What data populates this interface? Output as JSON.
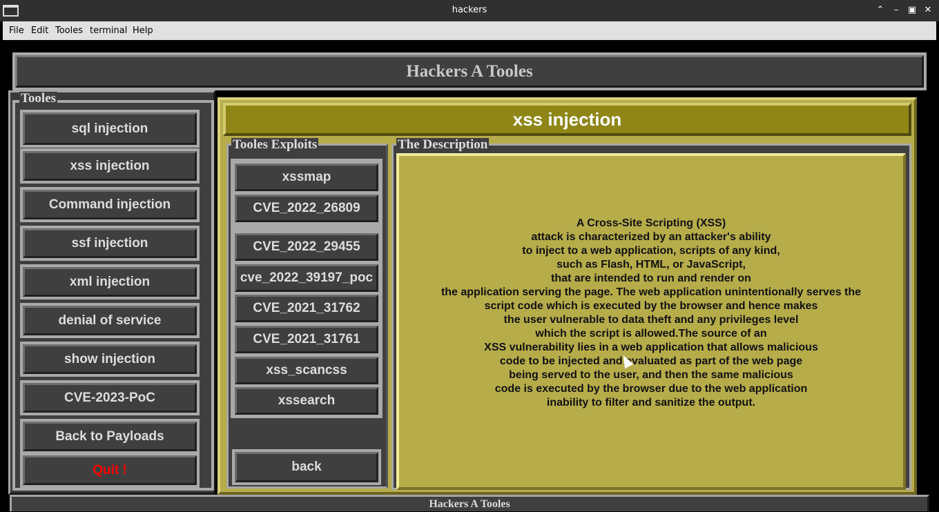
{
  "window": {
    "title": "hackers",
    "controls": [
      "chevron-up",
      "minimize",
      "maximize",
      "close"
    ]
  },
  "menubar": {
    "items": [
      "File",
      "Edit",
      "Tooles",
      "terminal",
      "Help"
    ]
  },
  "header": {
    "title": "Hackers A Tooles"
  },
  "tooles_panel": {
    "label": "Tooles",
    "buttons": [
      "sql injection",
      "xss injection",
      "Command injection",
      "ssf injection",
      "xml injection",
      "denial of service",
      "show injection",
      "CVE-2023-PoC",
      "Back to Payloads"
    ],
    "quit_label": "Quit !"
  },
  "section": {
    "title": "xss injection"
  },
  "exploits_panel": {
    "label": "Tooles Exploits",
    "buttons": [
      "xssmap",
      "CVE_2022_26809",
      "CVE_2022_29455",
      "cve_2022_39197_poc",
      "CVE_2021_31762",
      "CVE_2021_31761",
      "xss_scancss",
      "xssearch"
    ],
    "back_label": "back"
  },
  "description_panel": {
    "label": "The Description",
    "lines": [
      "A Cross-Site Scripting (XSS)",
      "attack is characterized by an attacker's ability",
      "to inject to a web application, scripts of any kind,",
      "such as Flash, HTML, or JavaScript,",
      "that are intended to run and render on",
      "the application serving the page. The web application unintentionally serves the",
      "script code which is executed by the browser and hence makes",
      "the user vulnerable to data theft and any privileges level",
      "which the script is allowed.The source of an",
      "XSS vulnerability lies in a web application that allows malicious",
      "code to be injected and evaluated as part of the web page",
      "being served to the user, and then the same malicious",
      "code is executed by the browser due to the web application",
      "inability to filter and sanitize the output."
    ]
  },
  "status_bar": {
    "text": "Hackers A Tooles"
  },
  "colors": {
    "accent": "#8f8617",
    "panel_bg": "#b6ac4a",
    "button_bg": "#3f3f3f",
    "quit_text": "#ff0000"
  }
}
